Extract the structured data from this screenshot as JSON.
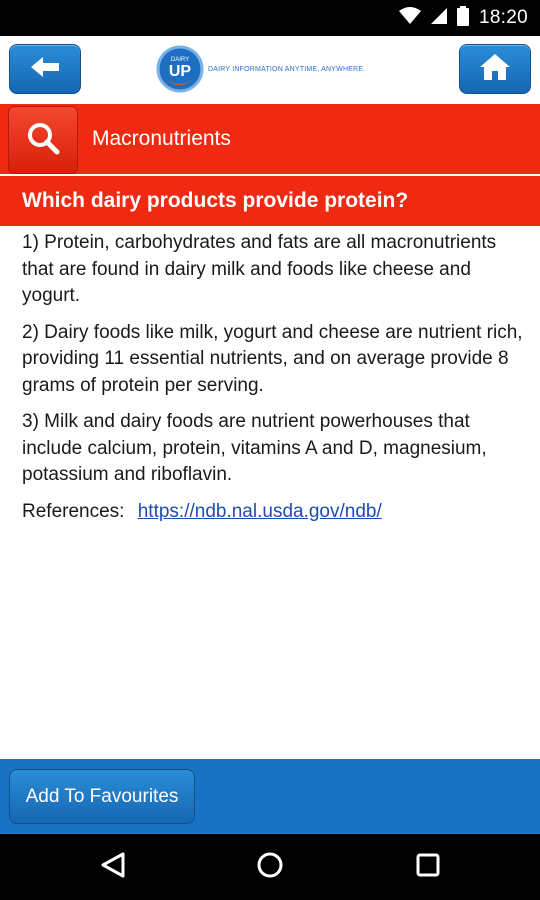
{
  "status_bar": {
    "time": "18:20"
  },
  "header": {
    "logo_top": "DAIRY",
    "logo_main": "UP",
    "logo_tagline": "DAIRY INFORMATION ANYTIME, ANYWHERE."
  },
  "section": {
    "title": "Macronutrients"
  },
  "question": {
    "title": "Which dairy products provide protein?"
  },
  "content": {
    "paragraphs": [
      "1) Protein, carbohydrates and fats are all macronutrients that are found in dairy milk and foods like cheese and yogurt.",
      "2) Dairy foods like milk, yogurt and cheese are nutrient rich, providing 11 essential nutrients, and on average provide 8 grams of protein per serving.",
      "3) Milk and dairy foods are nutrient powerhouses that include calcium, protein, vitamins A and D, magnesium, potassium and riboflavin."
    ],
    "references_label": "References:",
    "references_link": "https://ndb.nal.usda.gov/ndb/"
  },
  "bottom": {
    "favourites_label": "Add To Favourites"
  },
  "colors": {
    "red": "#f02a12",
    "blue": "#1a73c2",
    "link": "#1a4fb0"
  }
}
